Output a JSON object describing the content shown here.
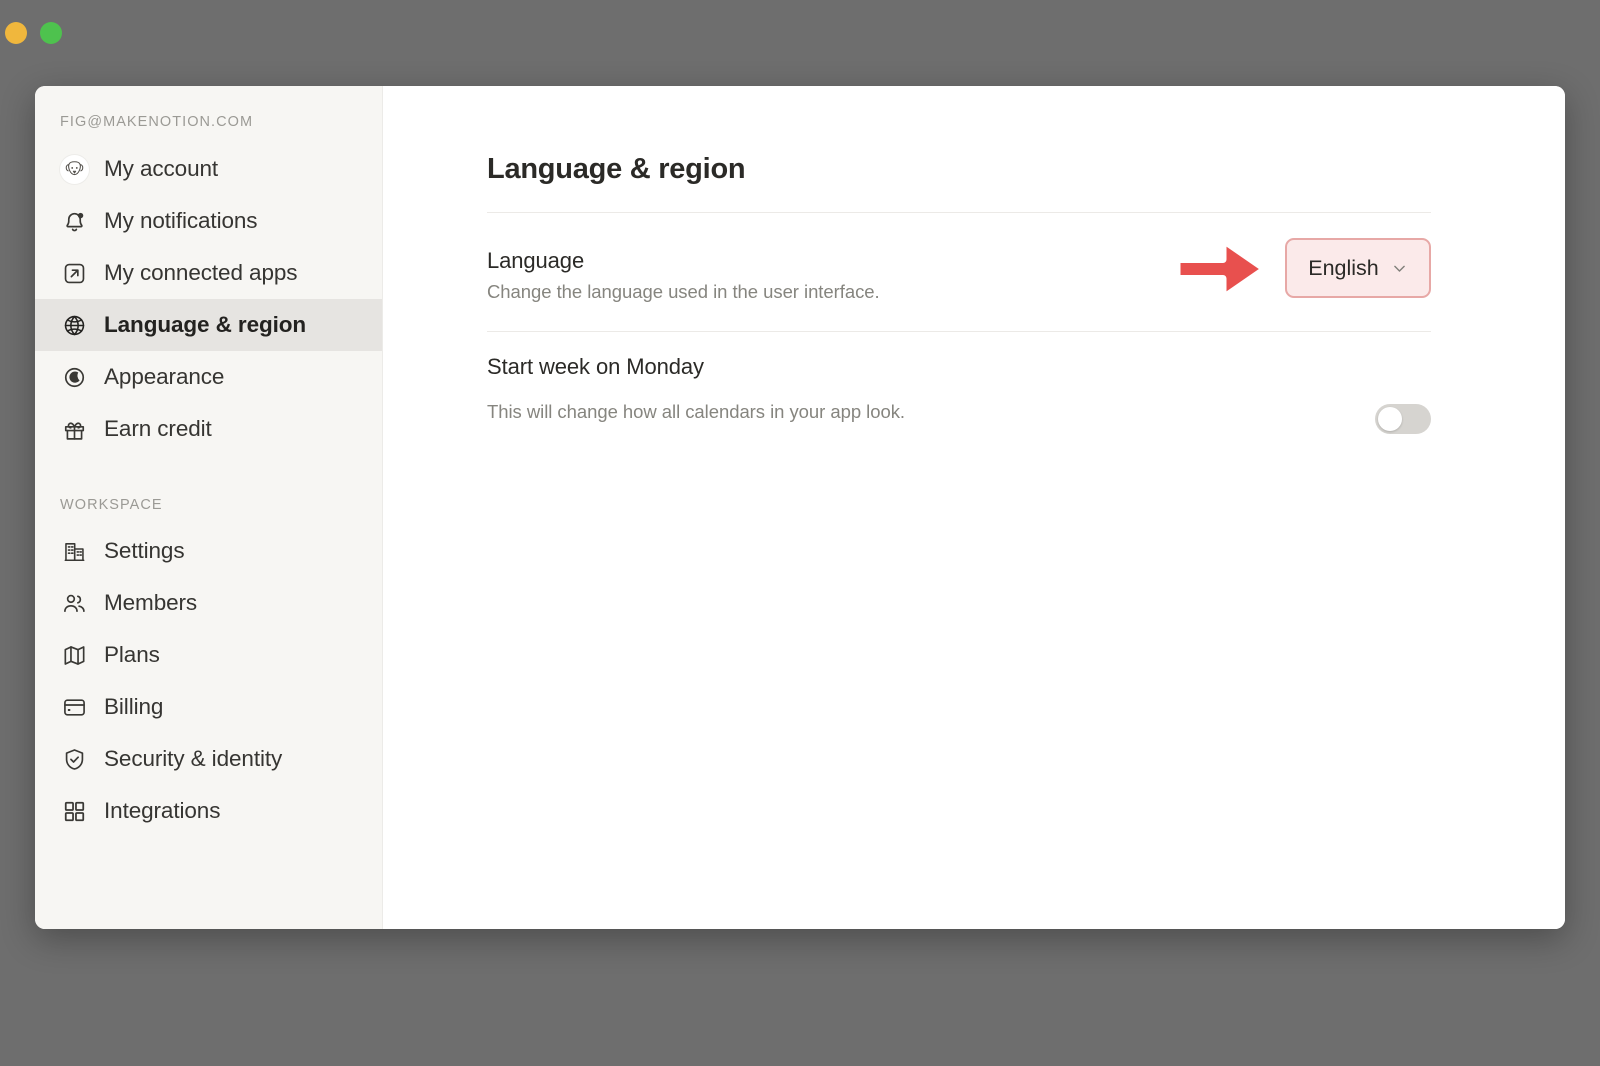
{
  "window": {
    "traffic_lights": [
      {
        "name": "minimize",
        "color": "#f0b73d"
      },
      {
        "name": "maximize",
        "color": "#4ec24e"
      }
    ]
  },
  "sidebar": {
    "account_email": "FIG@MAKENOTION.COM",
    "workspace_label": "WORKSPACE",
    "personal_items": [
      {
        "label": "My account",
        "icon": "avatar-icon",
        "active": false
      },
      {
        "label": "My notifications",
        "icon": "bell-icon",
        "active": false
      },
      {
        "label": "My connected apps",
        "icon": "external-link-icon",
        "active": false
      },
      {
        "label": "Language & region",
        "icon": "globe-icon",
        "active": true
      },
      {
        "label": "Appearance",
        "icon": "moon-icon",
        "active": false
      },
      {
        "label": "Earn credit",
        "icon": "gift-icon",
        "active": false
      }
    ],
    "workspace_items": [
      {
        "label": "Settings",
        "icon": "building-icon",
        "active": false
      },
      {
        "label": "Members",
        "icon": "people-icon",
        "active": false
      },
      {
        "label": "Plans",
        "icon": "map-icon",
        "active": false
      },
      {
        "label": "Billing",
        "icon": "credit-card-icon",
        "active": false
      },
      {
        "label": "Security & identity",
        "icon": "shield-check-icon",
        "active": false
      },
      {
        "label": "Integrations",
        "icon": "grid-icon",
        "active": false
      }
    ]
  },
  "main": {
    "page_title": "Language & region",
    "rows": [
      {
        "title": "Language",
        "description": "Change the language used in the user interface.",
        "control": "dropdown",
        "value": "English"
      },
      {
        "title": "Start week on Monday",
        "description": "This will change how all calendars in your app look.",
        "control": "toggle",
        "value": "off"
      }
    ]
  },
  "annotation": {
    "type": "arrow-right-sticker",
    "target": "language-dropdown",
    "color": "#e8504e",
    "outline_color": "#ffffff"
  },
  "colors": {
    "desktop_background": "#6e6e6e",
    "window_background": "#ffffff",
    "sidebar_background": "#f7f6f3",
    "sidebar_active": "#e6e4e1",
    "divider": "#eceae7",
    "text_primary": "#2b2a27",
    "text_muted": "#86857f",
    "highlight_fill": "#fbeaea",
    "highlight_border": "#e7a8a6",
    "toggle_off": "#d6d4d0"
  }
}
